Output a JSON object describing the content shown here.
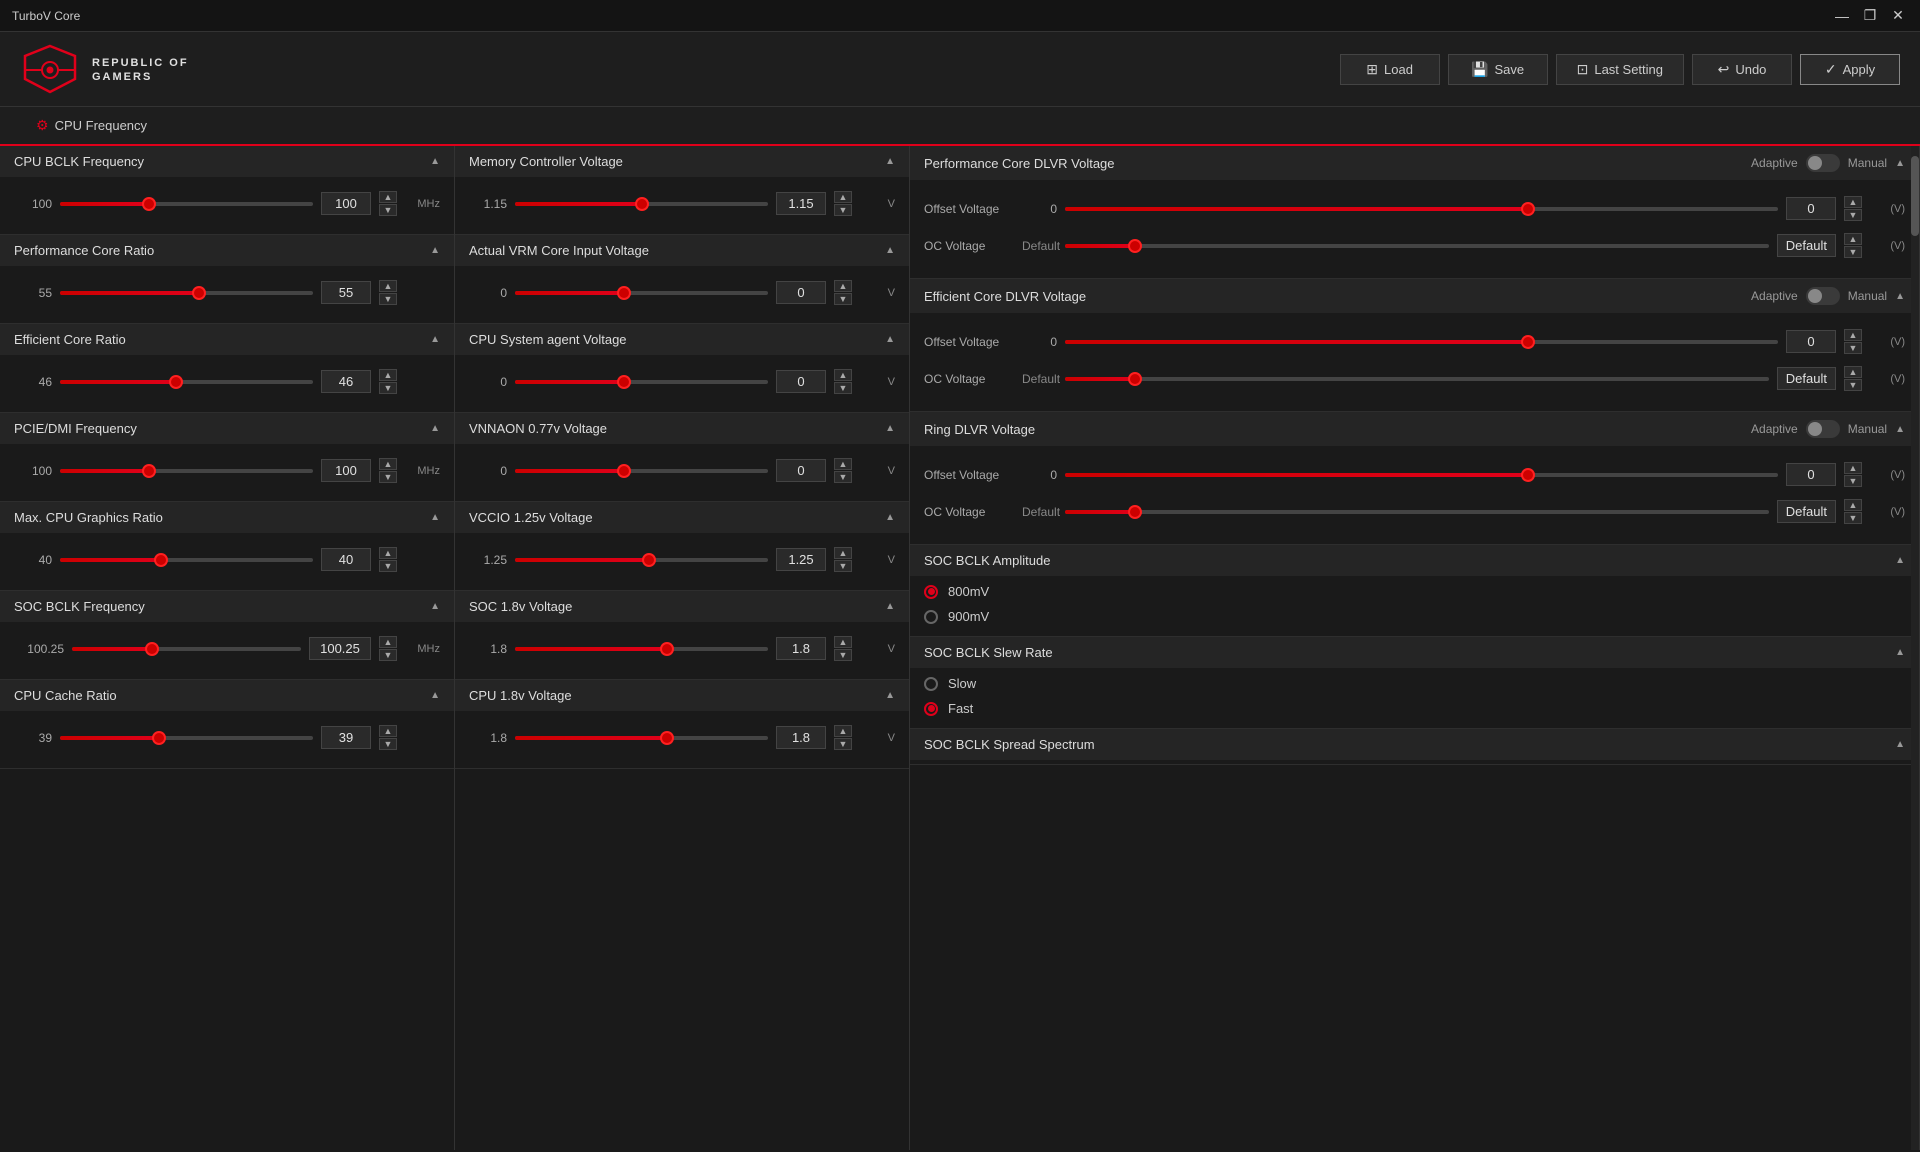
{
  "app": {
    "title": "TurboV Core",
    "titlebar": {
      "minimize_label": "—",
      "maximize_label": "❐",
      "close_label": "✕"
    }
  },
  "header": {
    "logo_line1": "REPUBLIC OF",
    "logo_line2": "GAMERS",
    "buttons": {
      "load": "Load",
      "save": "Save",
      "last_setting": "Last Setting",
      "undo": "Undo",
      "apply": "Apply"
    }
  },
  "tabs": [
    {
      "id": "cpu-freq",
      "label": "CPU Frequency",
      "active": true
    }
  ],
  "columns": {
    "left": {
      "sections": [
        {
          "id": "cpu-bclk",
          "title": "CPU BCLK Frequency",
          "value": 100,
          "display_value": "100",
          "unit": "MHz",
          "fill_pct": 35
        },
        {
          "id": "perf-core-ratio",
          "title": "Performance Core Ratio",
          "value": 55,
          "display_value": "55",
          "unit": "",
          "fill_pct": 55
        },
        {
          "id": "eff-core-ratio",
          "title": "Efficient Core Ratio",
          "value": 46,
          "display_value": "46",
          "unit": "",
          "fill_pct": 46
        },
        {
          "id": "pcie-dmi",
          "title": "PCIE/DMI Frequency",
          "value": 100,
          "display_value": "100",
          "unit": "MHz",
          "fill_pct": 35
        },
        {
          "id": "max-cpu-graphics",
          "title": "Max. CPU Graphics Ratio",
          "value": 40,
          "display_value": "40",
          "unit": "",
          "fill_pct": 40
        },
        {
          "id": "soc-bclk-freq",
          "title": "SOC BCLK Frequency",
          "value": 100.25,
          "display_value": "100.25",
          "unit": "MHz",
          "fill_pct": 35
        },
        {
          "id": "cpu-cache-ratio",
          "title": "CPU Cache Ratio",
          "value": 39,
          "display_value": "39",
          "unit": "",
          "fill_pct": 39
        }
      ]
    },
    "middle": {
      "sections": [
        {
          "id": "mem-ctrl-voltage",
          "title": "Memory Controller Voltage",
          "value": 1.15,
          "display_value": "1.15",
          "unit": "V",
          "fill_pct": 50
        },
        {
          "id": "actual-vrm",
          "title": "Actual VRM Core Input Voltage",
          "value": 0,
          "display_value": "0",
          "unit": "V",
          "fill_pct": 43
        },
        {
          "id": "cpu-sys-agent",
          "title": "CPU System agent Voltage",
          "value": 0,
          "display_value": "0",
          "unit": "V",
          "fill_pct": 43
        },
        {
          "id": "vnnaon",
          "title": "VNNAON 0.77v Voltage",
          "value": 0,
          "display_value": "0",
          "unit": "V",
          "fill_pct": 43
        },
        {
          "id": "vccio",
          "title": "VCCIO 1.25v Voltage",
          "value": 1.25,
          "display_value": "1.25",
          "unit": "V",
          "fill_pct": 53
        },
        {
          "id": "soc-1v8",
          "title": "SOC 1.8v Voltage",
          "value": 1.8,
          "display_value": "1.8",
          "unit": "V",
          "fill_pct": 60
        },
        {
          "id": "cpu-1v8",
          "title": "CPU 1.8v Voltage",
          "value": 1.8,
          "display_value": "1.8",
          "unit": "V",
          "fill_pct": 60
        }
      ]
    },
    "right": {
      "sections": [
        {
          "id": "perf-core-dlvr",
          "title": "Performance Core DLVR Voltage",
          "adaptive_manual": true,
          "offset_voltage": {
            "label": "Offset Voltage",
            "value": 0,
            "fill_pct": 65
          },
          "oc_voltage": {
            "label": "OC Voltage",
            "value": "Default",
            "fill_pct": 10
          }
        },
        {
          "id": "eff-core-dlvr",
          "title": "Efficient Core DLVR Voltage",
          "adaptive_manual": true,
          "offset_voltage": {
            "label": "Offset Voltage",
            "value": 0,
            "fill_pct": 65
          },
          "oc_voltage": {
            "label": "OC Voltage",
            "value": "Default",
            "fill_pct": 10
          }
        },
        {
          "id": "ring-dlvr",
          "title": "Ring DLVR Voltage",
          "adaptive_manual": true,
          "offset_voltage": {
            "label": "Offset Voltage",
            "value": 0,
            "fill_pct": 65
          },
          "oc_voltage": {
            "label": "OC Voltage",
            "value": "Default",
            "fill_pct": 10
          }
        },
        {
          "id": "soc-bclk-amplitude",
          "title": "SOC BCLK Amplitude",
          "radio_options": [
            {
              "label": "800mV",
              "selected": true
            },
            {
              "label": "900mV",
              "selected": false
            }
          ]
        },
        {
          "id": "soc-bclk-slew",
          "title": "SOC BCLK Slew Rate",
          "radio_options": [
            {
              "label": "Slow",
              "selected": false
            },
            {
              "label": "Fast",
              "selected": true
            }
          ]
        },
        {
          "id": "soc-bclk-spread",
          "title": "SOC BCLK Spread Spectrum"
        }
      ]
    }
  },
  "ui": {
    "toggle_adaptive": "Adaptive",
    "toggle_manual": "Manual",
    "default_label": "Default",
    "collapse_char": "▲",
    "up_arrow": "▲",
    "down_arrow": "▼"
  }
}
